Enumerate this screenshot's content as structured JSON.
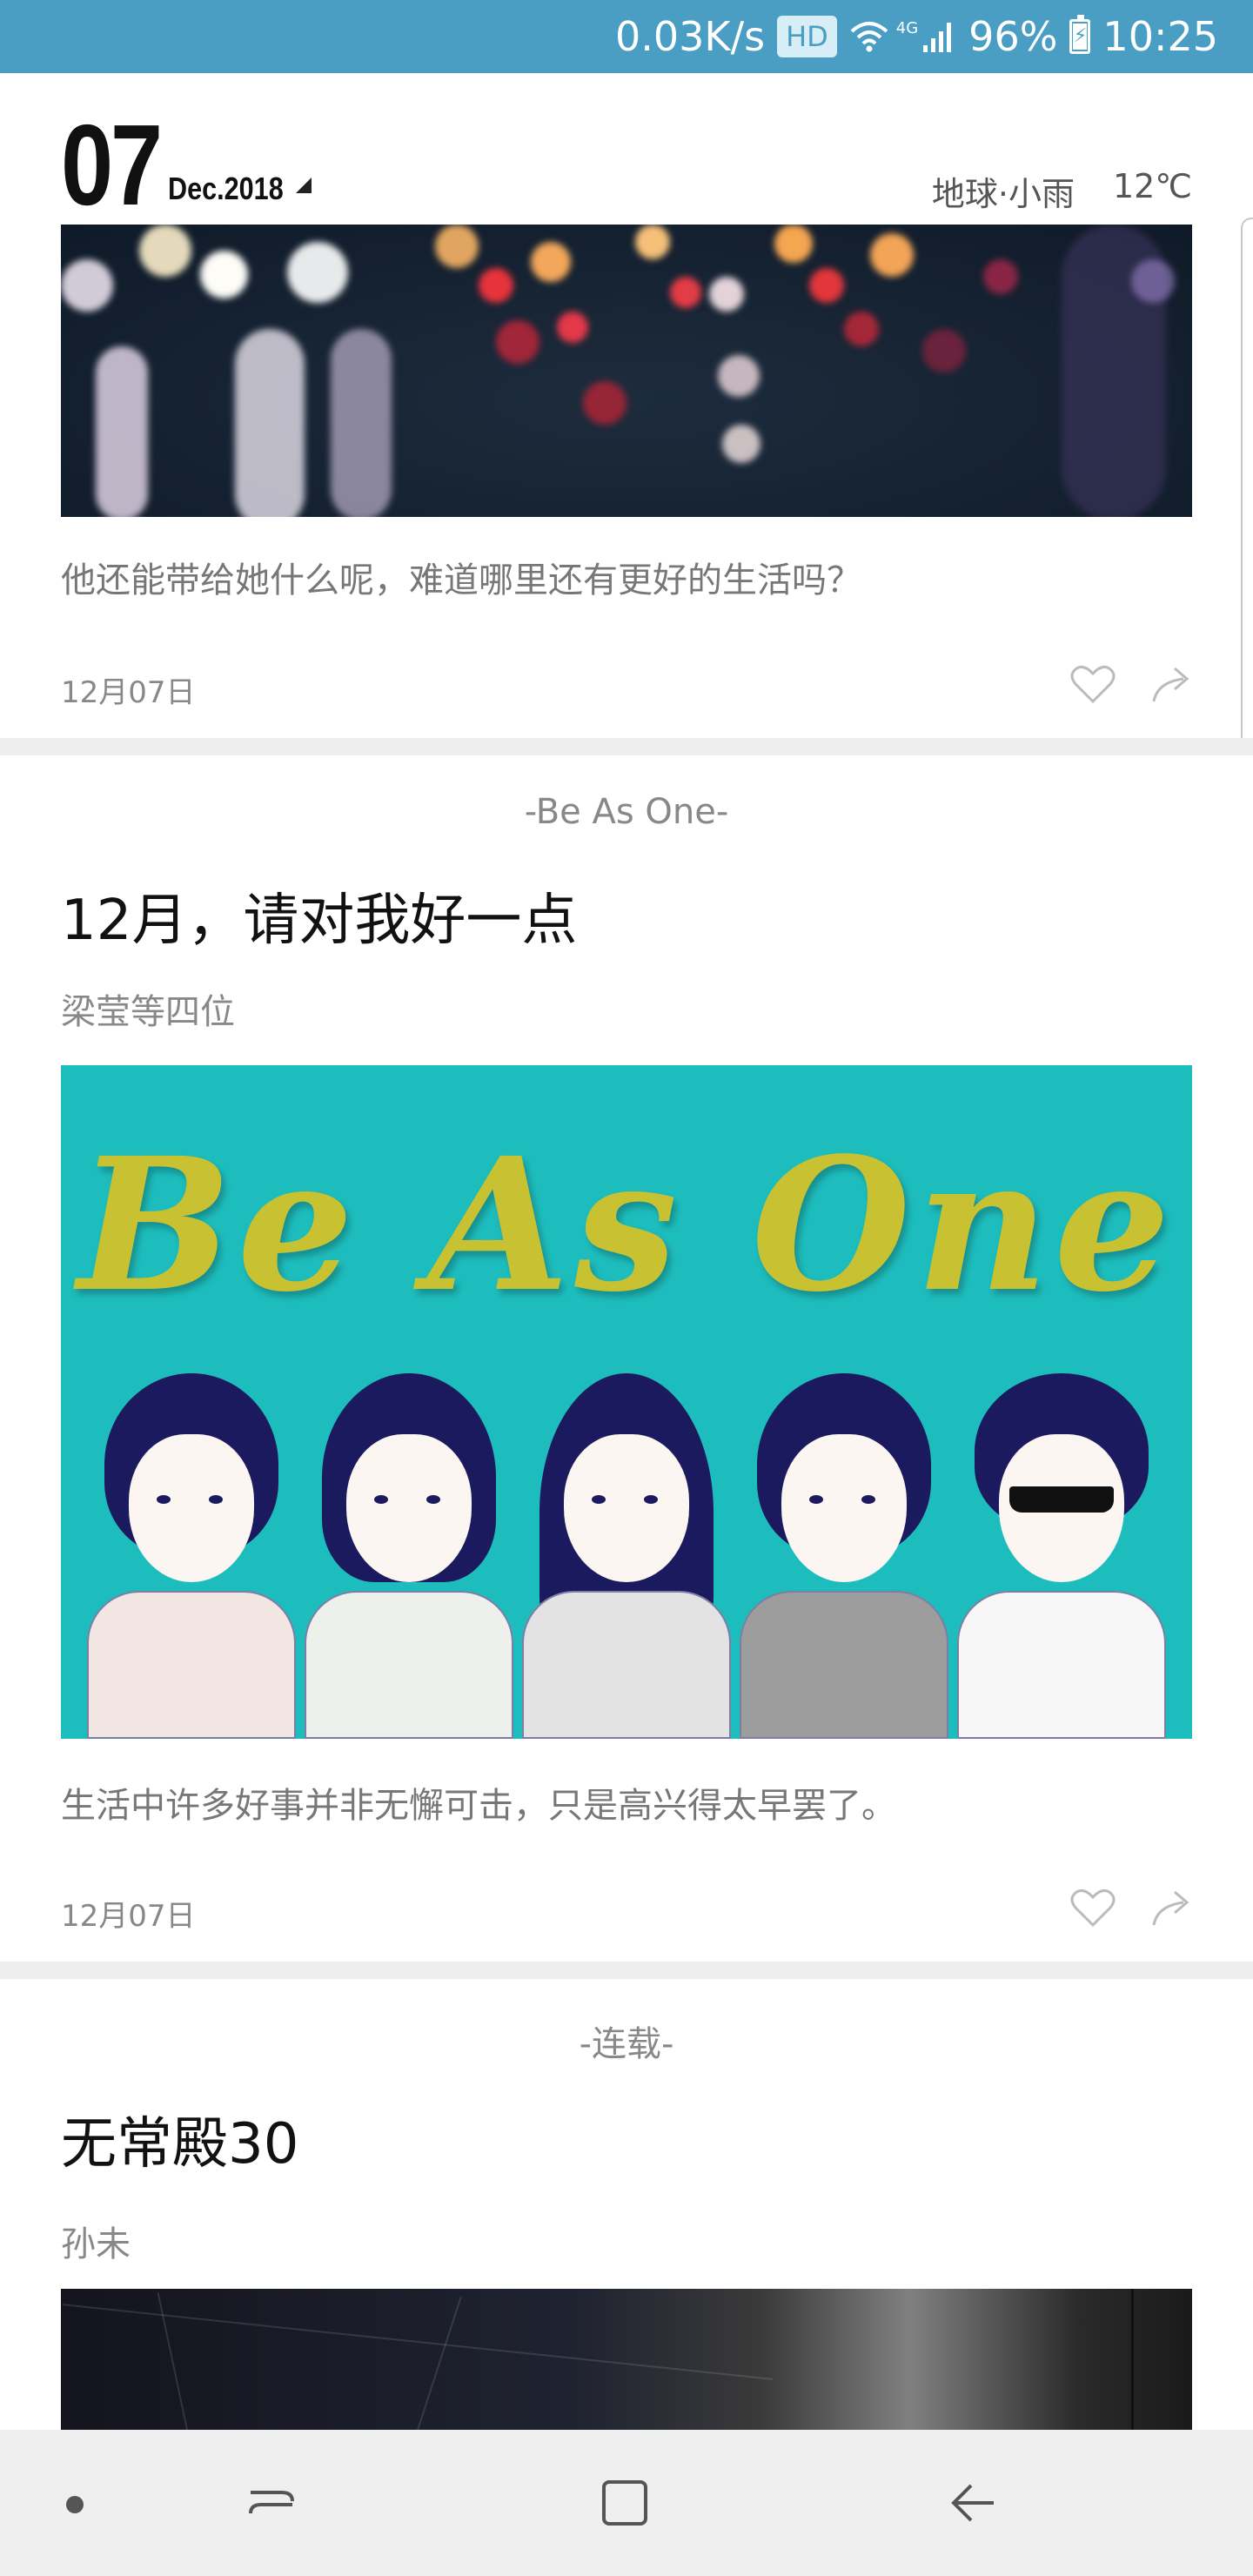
{
  "status_bar": {
    "net_speed": "0.03K/s",
    "hd_badge": "HD",
    "network": "4G",
    "battery": "96%",
    "time": "10:25"
  },
  "header": {
    "day": "07",
    "month": "Dec.2018",
    "weather_location": "地球·小雨",
    "temperature": "12℃"
  },
  "cards": [
    {
      "summary": "他还能带给她什么呢，难道哪里还有更好的生活吗？",
      "date": "12月07日"
    },
    {
      "tag": "-Be As One-",
      "title": "12月，请对我好一点",
      "author": "梁莹等四位",
      "image_title": "Be As One",
      "summary": "生活中许多好事并非无懈可击，只是高兴得太早罢了。",
      "date": "12月07日"
    },
    {
      "tag": "-连载-",
      "title": "无常殿30",
      "author": "孙未"
    }
  ],
  "colors": {
    "status_bar": "#4a9dc3",
    "poster_bg": "#1ebdbd",
    "poster_title": "#c8c233",
    "divider": "#eeeeee"
  },
  "icons": [
    "wifi-icon",
    "signal-icon",
    "battery-icon",
    "like-icon",
    "share-icon",
    "recents-icon",
    "home-icon",
    "back-icon"
  ]
}
